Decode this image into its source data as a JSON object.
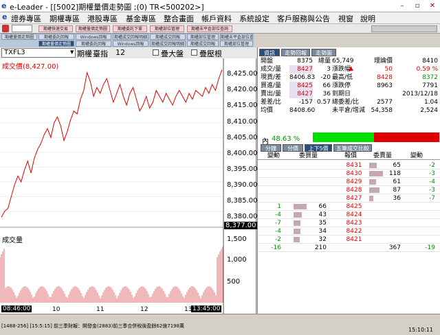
{
  "window": {
    "title": "e-Leader - [[5002]期權量價走勢圖 ;(0) TR<500202>]",
    "min": "–",
    "max": "▫",
    "close": "✕"
  },
  "menu": [
    "證券專區",
    "期權專區",
    "港股專區",
    "基金專區",
    "整合畫面",
    "帳戶資料",
    "系統設定",
    "客戶服務與公告",
    "視窗",
    "說明"
  ],
  "toolbar_tabs": [
    "期權快速交易",
    "期權量價走勢圖",
    "期權委託下單",
    "期權部位管理",
    "期權未平倉部位查詢"
  ],
  "sub_tabs": [
    "期權量價走勢圖",
    "期權委託回報",
    "Windows回報",
    "期權成交回報明細",
    "期權成交回報",
    "期權部位管理",
    "期權未平倉部位查詢"
  ],
  "controls": {
    "symbol": "TXFL3",
    "field1": "期權",
    "field2": "臺指",
    "count": "12",
    "chk1": "疊大盤",
    "chk2": "疊壓根"
  },
  "price_panel": {
    "label": "成交價(8,427.00)",
    "axis": [
      "8,425.00",
      "8,420.00",
      "8,415.00",
      "8,410.00",
      "8,405.00",
      "8,400.00",
      "8,395.00",
      "8,390.00",
      "8,385.00",
      "8,380.00"
    ],
    "current": "8,377.00"
  },
  "volume_panel": {
    "label": "成交量",
    "axis": [
      "1,500",
      "1,000",
      "500"
    ]
  },
  "time_axis": {
    "start": "08:46:00",
    "end": "13:45:00",
    "ticks": [
      "10",
      "11",
      "12",
      "13"
    ],
    "scroll": "303"
  },
  "chart_data": {
    "type": "line",
    "x_range": [
      "08:46:00",
      "13:45:00"
    ],
    "price_ylim": [
      8376,
      8430
    ],
    "price": [
      8378,
      8380,
      8381,
      8385,
      8389,
      8392,
      8390,
      8394,
      8397,
      8393,
      8398,
      8401,
      8403,
      8406,
      8408,
      8405,
      8410,
      8412,
      8409,
      8404,
      8407,
      8411,
      8414,
      8413,
      8418,
      8421,
      8427,
      8424,
      8419,
      8422,
      8420,
      8423,
      8425,
      8421,
      8417,
      8420,
      8423,
      8419,
      8416,
      8420,
      8422,
      8418,
      8414,
      8416,
      8419,
      8415,
      8417,
      8421,
      8419,
      8417,
      8420,
      8418,
      8416,
      8419,
      8421,
      8419,
      8417,
      8420,
      8418,
      8421,
      8420,
      8419,
      8422,
      8420,
      8423,
      8421,
      8425,
      8428
    ]
  },
  "right_tabs": [
    "資訊",
    "走勢回報",
    "走勢圖"
  ],
  "quote": [
    [
      "開盤",
      "8375",
      "總量",
      "65,749",
      "理論價",
      "8410"
    ],
    [
      "成交/量",
      "8427",
      "3",
      "漲跌幅",
      "50",
      "0.59 %"
    ],
    [
      "現貨/差",
      "8406.83",
      "-20",
      "最高/低",
      "8428",
      "8372"
    ],
    [
      "買進/量",
      "8425",
      "66",
      "漲跌停",
      "8963",
      "7791"
    ],
    [
      "賣出/量",
      "8427",
      "36",
      "到期日",
      "",
      "2013/12/18"
    ],
    [
      "差差/比",
      "-157",
      "0.57",
      "總委差/比",
      "2577",
      "1.04"
    ],
    [
      "均價",
      "8408.60",
      "",
      "未平倉/增減",
      "54,358",
      "2,524"
    ]
  ],
  "ratio": {
    "label": "內",
    "value": "48.63 %"
  },
  "book_tabs": [
    "分鐘",
    "分價",
    "上下5價",
    "五筆成交比較"
  ],
  "book_headers": [
    "變動",
    "委買量",
    "報價",
    "委賣量",
    "變動"
  ],
  "book": [
    [
      "",
      "",
      "8431",
      "65",
      "-2"
    ],
    [
      "",
      "",
      "8430",
      "118",
      "-3"
    ],
    [
      "",
      "",
      "8429",
      "61",
      "-4"
    ],
    [
      "",
      "",
      "8428",
      "87",
      "-3"
    ],
    [
      "",
      "",
      "8427",
      "36",
      "-7"
    ],
    [
      "1",
      "66",
      "8425",
      "",
      ""
    ],
    [
      "-4",
      "43",
      "8424",
      "",
      ""
    ],
    [
      "-7",
      "35",
      "8423",
      "",
      ""
    ],
    [
      "-4",
      "34",
      "8422",
      "",
      ""
    ],
    [
      "-2",
      "32",
      "8421",
      "",
      ""
    ],
    [
      "-16",
      "210",
      "",
      "367",
      "-19"
    ]
  ],
  "status": {
    "line1": "[1488-256] [15:5:15] 前三季財報：開發金(2883)前三季合併稅後盈餘62億7198萬",
    "time": "15:10:11"
  },
  "colors": {
    "red": "#e00000",
    "green": "#009000",
    "blue": "#1a4fa0"
  }
}
